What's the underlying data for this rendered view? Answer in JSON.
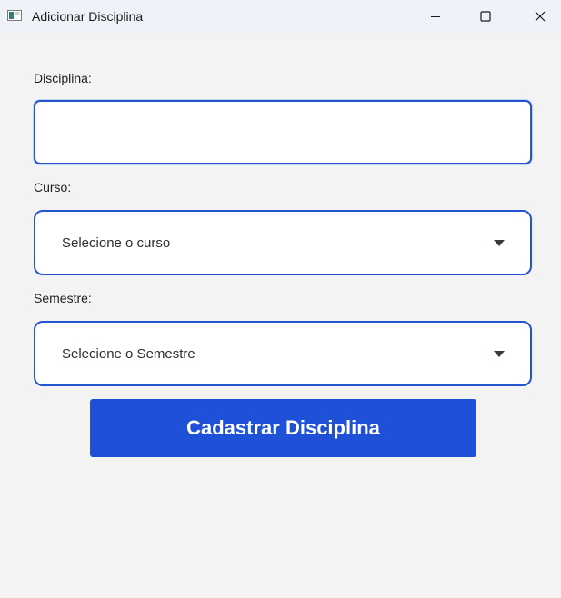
{
  "window": {
    "title": "Adicionar Disciplina",
    "icon": "app-window-icon",
    "controls": [
      "minimize-icon",
      "maximize-icon",
      "close-icon"
    ]
  },
  "form": {
    "disciplina": {
      "label": "Disciplina:",
      "value": ""
    },
    "curso": {
      "label": "Curso:",
      "selected": "Selecione o curso"
    },
    "semestre": {
      "label": "Semestre:",
      "selected": "Selecione o Semestre"
    },
    "submit_label": "Cadastrar Disciplina"
  },
  "colors": {
    "accent": "#1f50d8",
    "border": "#2454d1",
    "background": "#f3f3f3",
    "titlebar": "#eff3f9"
  }
}
